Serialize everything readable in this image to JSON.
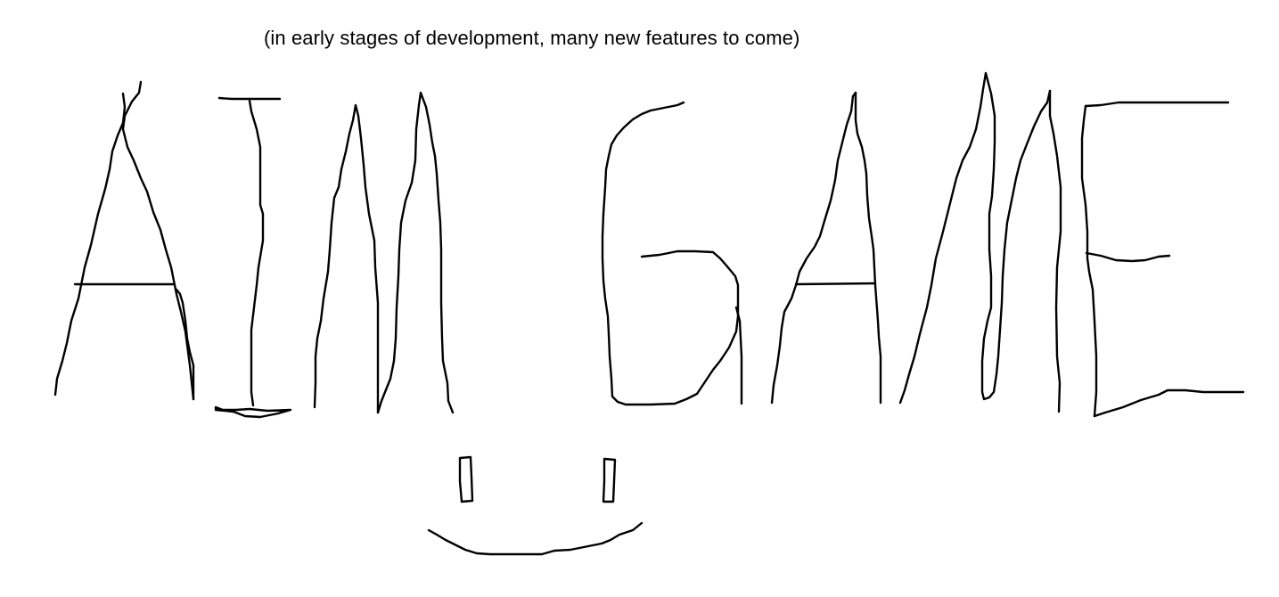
{
  "subtitle": "(in early stages of development, many new features to come)",
  "title_drawing": {
    "letters": [
      "A",
      "I",
      "M",
      "G",
      "A",
      "M",
      "E"
    ],
    "style": "hand-drawn sketch",
    "stroke_color": "#000000"
  },
  "face_drawing": {
    "features": [
      "left-eye",
      "right-eye",
      "smile-mouth"
    ],
    "stroke_color": "#000000"
  },
  "background_color": "#ffffff"
}
